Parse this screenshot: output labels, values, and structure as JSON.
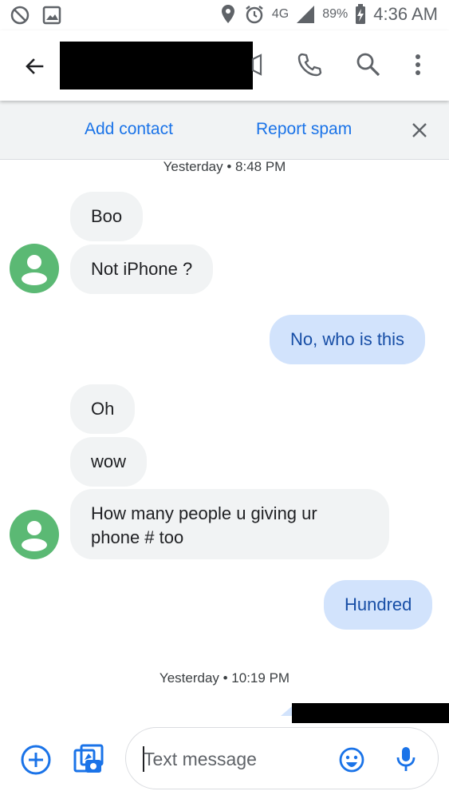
{
  "status_bar": {
    "battery": "89%",
    "time": "4:36 AM",
    "network": "4G",
    "icons": [
      "do-not-disturb-icon",
      "image-icon",
      "location-icon",
      "alarm-icon",
      "lte-icon",
      "signal-icon",
      "battery-charging-icon"
    ]
  },
  "app_bar": {
    "icons": [
      "back-arrow-icon",
      "video-call-icon",
      "phone-icon",
      "search-icon",
      "more-vert-icon"
    ]
  },
  "action_bar": {
    "add_contact": "Add contact",
    "report_spam": "Report spam"
  },
  "conversation": {
    "timestamp_1": "Yesterday • 8:48 PM",
    "msg_1": "Boo",
    "msg_2": "Not iPhone ?",
    "msg_3": "No, who is this",
    "msg_4": "Oh",
    "msg_5": "wow",
    "msg_6": "How many people u giving ur phone # too",
    "msg_7": "Hundred",
    "timestamp_2": "Yesterday • 10:19 PM"
  },
  "compose": {
    "placeholder": "Text message",
    "icons": [
      "add-circle-icon",
      "gallery-icon",
      "emoji-icon",
      "mic-icon"
    ]
  },
  "colors": {
    "accent": "#1a73e8",
    "outgoing_bubble": "#d2e3fc",
    "outgoing_text": "#174ea6",
    "incoming_bubble": "#f1f3f4",
    "avatar": "#5bb974"
  }
}
